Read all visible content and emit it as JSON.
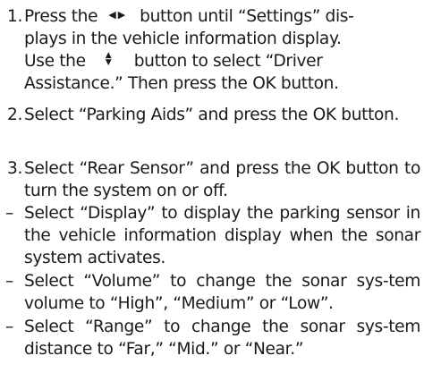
{
  "steps": [
    {
      "marker": "1.",
      "text_a": "Press the",
      "icon_lr": [
        "◀",
        "▶"
      ],
      "text_b": "button until “Settings” dis-",
      "text_c": "plays in the vehicle information display.",
      "text_d": "Use the",
      "icon_ud": [
        "▲",
        "▼"
      ],
      "text_e": "button to select “Driver",
      "text_f": "Assistance.” Then press the OK button."
    },
    {
      "marker": "2.",
      "text": "Select “Parking Aids” and press the OK button."
    },
    {
      "marker": "3.",
      "text": "Select “Rear Sensor” and press the OK button to turn the system on or off."
    }
  ],
  "bullets": [
    {
      "marker": "–",
      "text": "Select “Display” to display the parking sensor in the vehicle information display when the sonar system activates."
    },
    {
      "marker": "–",
      "text": "Select “Volume” to change the sonar sys-tem volume to “High”, “Medium” or “Low”."
    },
    {
      "marker": "–",
      "text": "Select “Range” to change the sonar sys-tem distance to “Far,” “Mid.” or “Near.”"
    }
  ]
}
